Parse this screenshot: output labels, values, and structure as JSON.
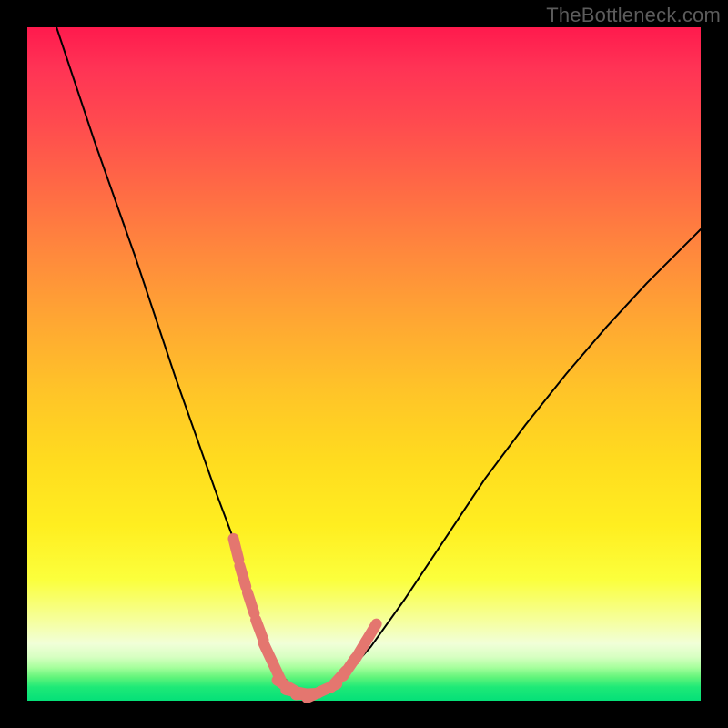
{
  "watermark": "TheBottleneck.com",
  "chart_data": {
    "type": "line",
    "title": "",
    "xlabel": "",
    "ylabel": "",
    "xlim": [
      0,
      100
    ],
    "ylim": [
      0,
      100
    ],
    "series": [
      {
        "name": "curve",
        "color": "#000000",
        "x": [
          4,
          7,
          10,
          13,
          16,
          19,
          22,
          25,
          28,
          31,
          33,
          34.5,
          36,
          38,
          40,
          42,
          44,
          47,
          51,
          56,
          62,
          68,
          74,
          80,
          86,
          92,
          98,
          100
        ],
        "y": [
          101,
          92,
          83,
          74.5,
          66,
          57,
          48,
          39.5,
          31,
          23,
          16,
          11,
          7,
          3.5,
          1.5,
          1,
          1.5,
          3.5,
          8,
          15,
          24,
          33,
          41,
          48.5,
          55.5,
          62,
          68,
          70
        ]
      }
    ],
    "markers": [
      {
        "name": "left-dash-segment",
        "color": "#e4766f",
        "points": [
          {
            "x": 31.0,
            "y": 22.5
          },
          {
            "x": 32.0,
            "y": 18.5
          },
          {
            "x": 33.2,
            "y": 14.5
          },
          {
            "x": 34.5,
            "y": 10.5
          },
          {
            "x": 35.8,
            "y": 7.0
          },
          {
            "x": 37.2,
            "y": 4.0
          }
        ]
      },
      {
        "name": "bottom-dash-segment",
        "color": "#e4766f",
        "points": [
          {
            "x": 38.5,
            "y": 2.2
          },
          {
            "x": 40.0,
            "y": 1.3
          },
          {
            "x": 41.5,
            "y": 1.0
          },
          {
            "x": 43.0,
            "y": 1.1
          },
          {
            "x": 44.5,
            "y": 1.8
          }
        ]
      },
      {
        "name": "right-dash-segment",
        "color": "#e4766f",
        "points": [
          {
            "x": 46.2,
            "y": 3.2
          },
          {
            "x": 47.8,
            "y": 5.0
          },
          {
            "x": 49.5,
            "y": 7.5
          },
          {
            "x": 51.0,
            "y": 10.0
          }
        ]
      }
    ]
  }
}
